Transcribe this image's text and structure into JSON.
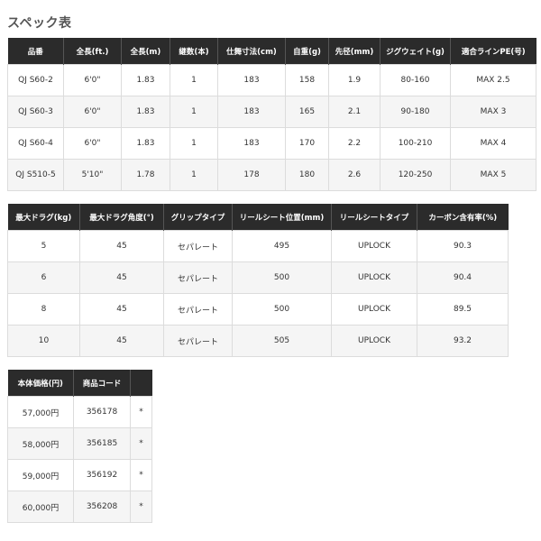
{
  "page": {
    "title": "スペック表"
  },
  "spec_table": {
    "headers": [
      "品番",
      "全長(ft.)",
      "全長(m)",
      "継数(本)",
      "仕舞寸法(cm)",
      "自重(g)",
      "先径(mm)",
      "ジグウェイト(g)",
      "適合ラインPE(号)"
    ],
    "rows": [
      [
        "QJ S60-2",
        "6'0\"",
        "1.83",
        "1",
        "183",
        "158",
        "1.9",
        "80-160",
        "MAX 2.5"
      ],
      [
        "QJ S60-3",
        "6'0\"",
        "1.83",
        "1",
        "183",
        "165",
        "2.1",
        "90-180",
        "MAX 3"
      ],
      [
        "QJ S60-4",
        "6'0\"",
        "1.83",
        "1",
        "183",
        "170",
        "2.2",
        "100-210",
        "MAX 4"
      ],
      [
        "QJ S510-5",
        "5'10\"",
        "1.78",
        "1",
        "178",
        "180",
        "2.6",
        "120-250",
        "MAX 5"
      ]
    ]
  },
  "drag_table": {
    "headers": [
      "最大ドラグ(kg)",
      "最大ドラグ角度(°)",
      "グリップタイプ",
      "リールシート位置(mm)",
      "リールシートタイプ",
      "カーボン含有率(%)"
    ],
    "rows": [
      [
        "5",
        "45",
        "セパレート",
        "495",
        "UPLOCK",
        "90.3"
      ],
      [
        "6",
        "45",
        "セパレート",
        "500",
        "UPLOCK",
        "90.4"
      ],
      [
        "8",
        "45",
        "セパレート",
        "500",
        "UPLOCK",
        "89.5"
      ],
      [
        "10",
        "45",
        "セパレート",
        "505",
        "UPLOCK",
        "93.2"
      ]
    ]
  },
  "price_table": {
    "headers": [
      "本体価格(円)",
      "商品コード",
      ""
    ],
    "rows": [
      [
        "57,000円",
        "356178",
        "*"
      ],
      [
        "58,000円",
        "356185",
        "*"
      ],
      [
        "59,000円",
        "356192",
        "*"
      ],
      [
        "60,000円",
        "356208",
        "*"
      ]
    ]
  }
}
